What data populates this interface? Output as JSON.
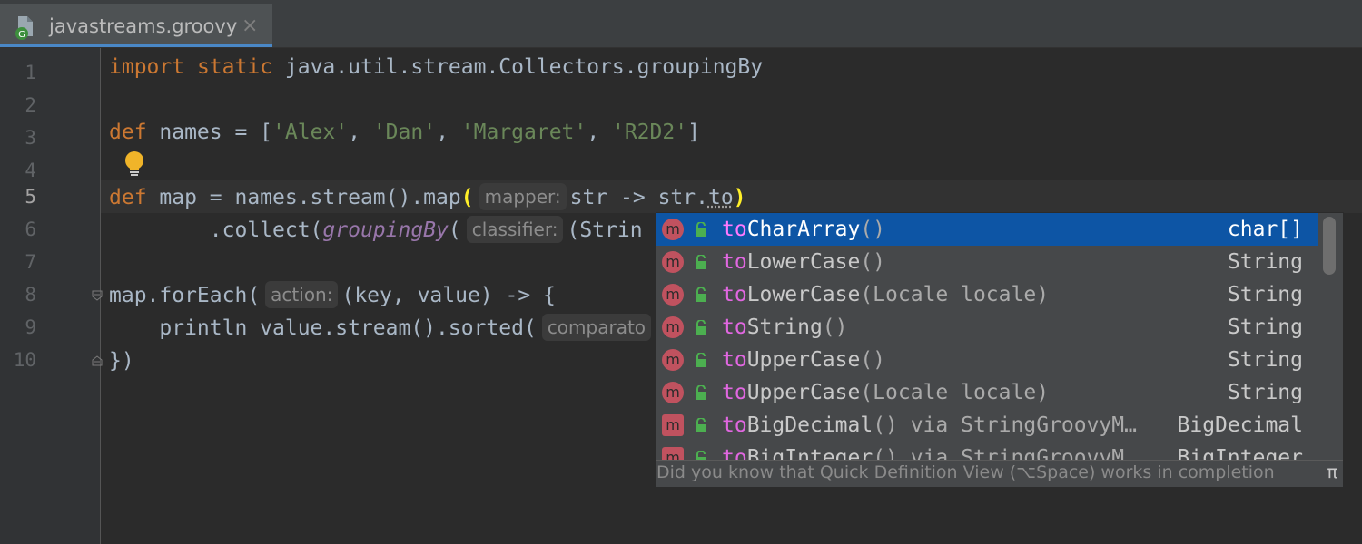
{
  "tab": {
    "title": "javastreams.groovy",
    "close": "×"
  },
  "line_numbers": [
    "1",
    "2",
    "3",
    "4",
    "5",
    "6",
    "7",
    "8",
    "9",
    "10"
  ],
  "code": {
    "l1_kw1": "import",
    "l1_kw2": "static",
    "l1_rest": " java.util.stream.Collectors.groupingBy",
    "l3_kw": "def",
    "l3_a": " names = [",
    "l3_s1": "'Alex'",
    "l3_c1": ", ",
    "l3_s2": "'Dan'",
    "l3_c2": ", ",
    "l3_s3": "'Margaret'",
    "l3_c3": ", ",
    "l3_s4": "'R2D2'",
    "l3_end": "]",
    "l5_kw": "def",
    "l5_a": " map = names.stream().map",
    "l5_open": "(",
    "l5_hint": "mapper:",
    "l5_b": "str -> str.",
    "l5_typed": "to",
    "l5_close": ")",
    "l6_a": "        .collect(",
    "l6_it": "groupingBy",
    "l6_paren": "(",
    "l6_hint": "classifier:",
    "l6_b": "(Strin",
    "l8_a": "map.forEach(",
    "l8_hint": "action:",
    "l8_b": "(key, value) -> {",
    "l9_a": "    println value.stream().sorted(",
    "l9_hint": "comparato",
    "l10_a": "})"
  },
  "completion": {
    "items": [
      {
        "prefix": "to",
        "name": "CharArray",
        "params": "()",
        "type": "char[]"
      },
      {
        "prefix": "to",
        "name": "LowerCase",
        "params": "()",
        "type": "String"
      },
      {
        "prefix": "to",
        "name": "LowerCase",
        "params": "(Locale locale)",
        "type": "String"
      },
      {
        "prefix": "to",
        "name": "String",
        "params": "()",
        "type": "String"
      },
      {
        "prefix": "to",
        "name": "UpperCase",
        "params": "()",
        "type": "String"
      },
      {
        "prefix": "to",
        "name": "UpperCase",
        "params": "(Locale locale)",
        "type": "String"
      },
      {
        "prefix": "to",
        "name": "BigDecimal",
        "params": "() via StringGroovyM…",
        "type": "BigDecimal"
      },
      {
        "prefix": "to",
        "name": "BigInteger",
        "params": "() via StringGroovyM…",
        "type": "BigInteger"
      }
    ],
    "icon_letter": "m",
    "footer": "Did you know that Quick Definition View (⌥Space) works in completion",
    "footer_icon": "π"
  },
  "colors": {
    "keyword": "#cc7832",
    "string": "#6a8759",
    "selection": "#0d55a5",
    "method_icon": "#c0525f",
    "tab_accent": "#4a88c7"
  }
}
